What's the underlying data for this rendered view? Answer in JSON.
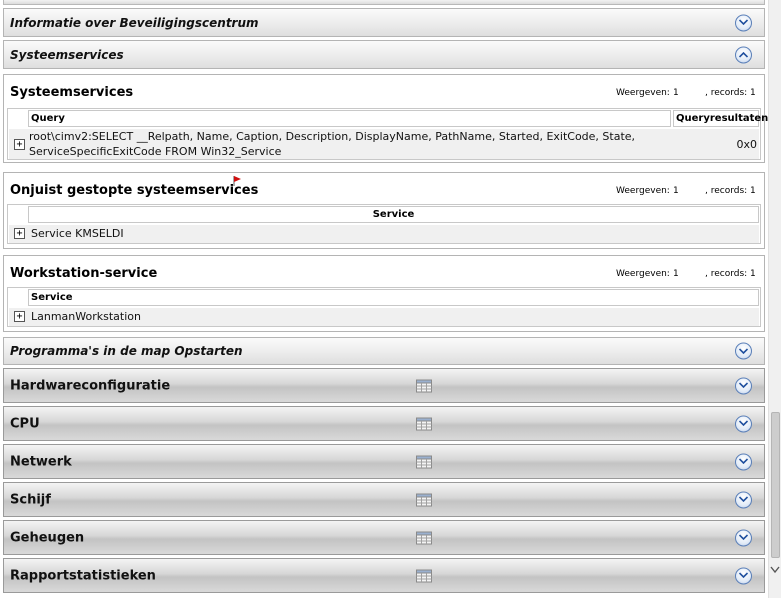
{
  "sections": {
    "security_center_info": {
      "title": "Informatie over Beveiligingscentrum"
    },
    "system_services": {
      "title": "Systeemservices"
    },
    "startup_programs": {
      "title": "Programma's in de map Opstarten"
    }
  },
  "panels": {
    "system_services": {
      "title": "Systeemservices",
      "show_label": "Weergeven:",
      "show_value": "1",
      "records_label": ", records:",
      "records_value": "1",
      "columns": [
        "Query",
        "Queryresultaten"
      ],
      "rows": [
        {
          "query_line1": "root\\cimv2:SELECT __Relpath, Name, Caption, Description, DisplayName, PathName, Started, ExitCode, State,",
          "query_line2": "ServiceSpecificExitCode FROM Win32_Service",
          "result": "0x0"
        }
      ]
    },
    "stopped_services": {
      "title": "Onjuist gestopte systeemservices",
      "show_label": "Weergeven:",
      "show_value": "1",
      "records_label": ", records:",
      "records_value": "1",
      "columns": [
        "Service"
      ],
      "rows": [
        {
          "service": "Service KMSELDI"
        }
      ]
    },
    "workstation_service": {
      "title": "Workstation-service",
      "show_label": "Weergeven:",
      "show_value": "1",
      "records_label": ", records:",
      "records_value": "1",
      "columns": [
        "Service"
      ],
      "rows": [
        {
          "service": "LanmanWorkstation"
        }
      ]
    }
  },
  "gray_sections": [
    {
      "title": "Hardwareconfiguratie"
    },
    {
      "title": "CPU"
    },
    {
      "title": "Netwerk"
    },
    {
      "title": "Schijf"
    },
    {
      "title": "Geheugen"
    },
    {
      "title": "Rapportstatistieken"
    }
  ],
  "colors": {
    "flag": "#d01010",
    "circle_border": "#5a7fb8"
  },
  "icons": {
    "expand": "chevron-down-icon",
    "collapse": "chevron-up-icon",
    "row_expander": "plus-box-icon",
    "table_view": "table-grid-icon",
    "flag": "red-flag-icon"
  }
}
